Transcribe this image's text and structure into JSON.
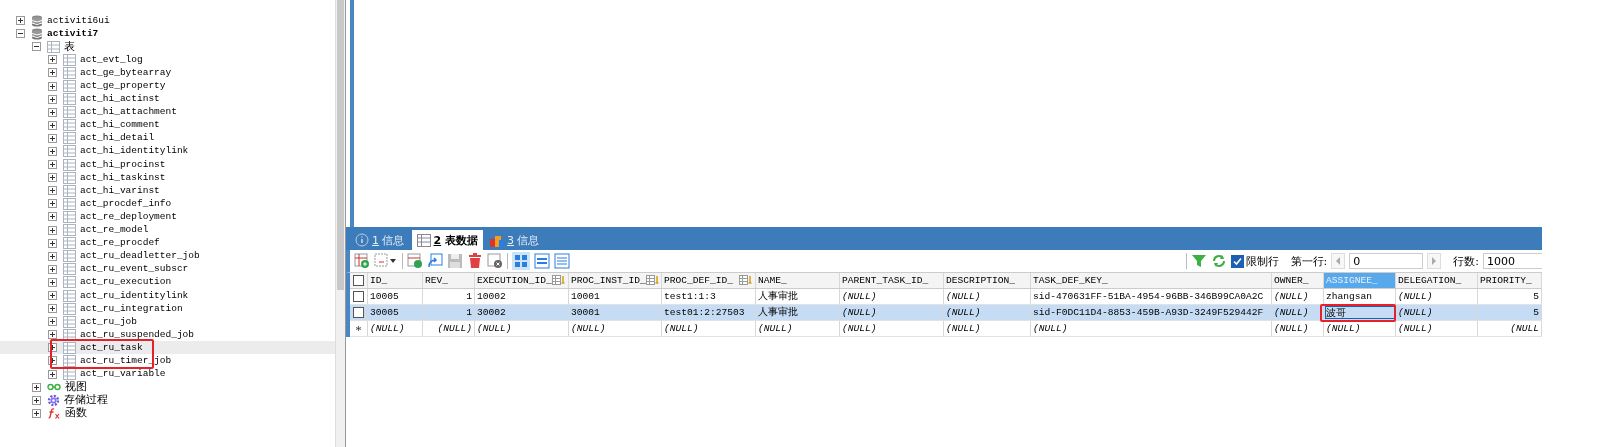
{
  "tree": [
    {
      "label": "activiti6ui",
      "kind": "database",
      "expanded": false,
      "selected": false
    },
    {
      "label": "activiti7",
      "kind": "database",
      "expanded": true,
      "selected": false,
      "children": [
        {
          "label": "表",
          "kind": "tables",
          "expanded": true,
          "selected": false,
          "children": [
            {
              "label": "act_evt_log",
              "kind": "table",
              "expanded": false,
              "selected": false
            },
            {
              "label": "act_ge_bytearray",
              "kind": "table",
              "expanded": false,
              "selected": false
            },
            {
              "label": "act_ge_property",
              "kind": "table",
              "expanded": false,
              "selected": false
            },
            {
              "label": "act_hi_actinst",
              "kind": "table",
              "expanded": false,
              "selected": false
            },
            {
              "label": "act_hi_attachment",
              "kind": "table",
              "expanded": false,
              "selected": false
            },
            {
              "label": "act_hi_comment",
              "kind": "table",
              "expanded": false,
              "selected": false
            },
            {
              "label": "act_hi_detail",
              "kind": "table",
              "expanded": false,
              "selected": false
            },
            {
              "label": "act_hi_identitylink",
              "kind": "table",
              "expanded": false,
              "selected": false
            },
            {
              "label": "act_hi_procinst",
              "kind": "table",
              "expanded": false,
              "selected": false
            },
            {
              "label": "act_hi_taskinst",
              "kind": "table",
              "expanded": false,
              "selected": false
            },
            {
              "label": "act_hi_varinst",
              "kind": "table",
              "expanded": false,
              "selected": false
            },
            {
              "label": "act_procdef_info",
              "kind": "table",
              "expanded": false,
              "selected": false
            },
            {
              "label": "act_re_deployment",
              "kind": "table",
              "expanded": false,
              "selected": false
            },
            {
              "label": "act_re_model",
              "kind": "table",
              "expanded": false,
              "selected": false
            },
            {
              "label": "act_re_procdef",
              "kind": "table",
              "expanded": false,
              "selected": false
            },
            {
              "label": "act_ru_deadletter_job",
              "kind": "table",
              "expanded": false,
              "selected": false
            },
            {
              "label": "act_ru_event_subscr",
              "kind": "table",
              "expanded": false,
              "selected": false
            },
            {
              "label": "act_ru_execution",
              "kind": "table",
              "expanded": false,
              "selected": false
            },
            {
              "label": "act_ru_identitylink",
              "kind": "table",
              "expanded": false,
              "selected": false
            },
            {
              "label": "act_ru_integration",
              "kind": "table",
              "expanded": false,
              "selected": false
            },
            {
              "label": "act_ru_job",
              "kind": "table",
              "expanded": false,
              "selected": false
            },
            {
              "label": "act_ru_suspended_job",
              "kind": "table",
              "expanded": false,
              "selected": false
            },
            {
              "label": "act_ru_task",
              "kind": "table",
              "expanded": false,
              "selected": true
            },
            {
              "label": "act_ru_timer_job",
              "kind": "table",
              "expanded": false,
              "selected": false
            },
            {
              "label": "act_ru_variable",
              "kind": "table",
              "expanded": false,
              "selected": false
            }
          ]
        },
        {
          "label": "视图",
          "kind": "views",
          "expanded": false,
          "selected": false
        },
        {
          "label": "存储过程",
          "kind": "procedures",
          "expanded": false,
          "selected": false
        },
        {
          "label": "函数",
          "kind": "functions",
          "expanded": false,
          "selected": false
        }
      ]
    }
  ],
  "tabs": [
    {
      "key": "1",
      "label": "信息",
      "kind": "info",
      "selected": false
    },
    {
      "key": "2",
      "label": "表数据",
      "kind": "table",
      "selected": true
    },
    {
      "key": "3",
      "label": "信息",
      "kind": "profile",
      "selected": false
    }
  ],
  "toolbar": {
    "limit_rows": {
      "label": "限制行",
      "checked": true
    },
    "first_row": {
      "label": "第一行:",
      "value": "0"
    },
    "row_count": {
      "label": "行数:",
      "value": "1000"
    }
  },
  "table": {
    "all_checked": false,
    "columns": [
      {
        "label": "ID_",
        "selected": false,
        "key_icon": false
      },
      {
        "label": "REV_",
        "selected": false,
        "key_icon": false
      },
      {
        "label": "EXECUTION_ID_",
        "selected": false,
        "key_icon": true
      },
      {
        "label": "PROC_INST_ID_",
        "selected": false,
        "key_icon": true
      },
      {
        "label": "PROC_DEF_ID_",
        "selected": false,
        "key_icon": true
      },
      {
        "label": "NAME_",
        "selected": false,
        "key_icon": false
      },
      {
        "label": "PARENT_TASK_ID_",
        "selected": false,
        "key_icon": false
      },
      {
        "label": "DESCRIPTION_",
        "selected": false,
        "key_icon": false
      },
      {
        "label": "TASK_DEF_KEY_",
        "selected": false,
        "key_icon": false
      },
      {
        "label": "OWNER_",
        "selected": false,
        "key_icon": false
      },
      {
        "label": "ASSIGNEE_",
        "selected": true,
        "key_icon": false
      },
      {
        "label": "DELEGATION_",
        "selected": false,
        "key_icon": false
      },
      {
        "label": "PRIORITY_",
        "selected": false,
        "key_icon": false
      }
    ],
    "rows": [
      {
        "kind": "data",
        "selected": false,
        "checked": false,
        "cells": [
          {
            "text": "10005",
            "null": false,
            "editing": false
          },
          {
            "text": "1",
            "null": false,
            "editing": false
          },
          {
            "text": "10002",
            "null": false,
            "editing": false
          },
          {
            "text": "10001",
            "null": false,
            "editing": false
          },
          {
            "text": "test1:1:3",
            "null": false,
            "editing": false
          },
          {
            "text": "人事审批",
            "null": false,
            "editing": false
          },
          {
            "text": "(NULL)",
            "null": true,
            "editing": false
          },
          {
            "text": "(NULL)",
            "null": true,
            "editing": false
          },
          {
            "text": "sid-470631FF-51BA-4954-96BB-346B99CA0A2C",
            "null": false,
            "editing": false
          },
          {
            "text": "(NULL)",
            "null": true,
            "editing": false
          },
          {
            "text": "zhangsan",
            "null": false,
            "editing": false
          },
          {
            "text": "(NULL)",
            "null": true,
            "editing": false
          },
          {
            "text": "5",
            "null": false,
            "editing": false
          }
        ]
      },
      {
        "kind": "data",
        "selected": true,
        "checked": false,
        "cells": [
          {
            "text": "30005",
            "null": false,
            "editing": false
          },
          {
            "text": "1",
            "null": false,
            "editing": false
          },
          {
            "text": "30002",
            "null": false,
            "editing": false
          },
          {
            "text": "30001",
            "null": false,
            "editing": false
          },
          {
            "text": "test01:2:27503",
            "null": false,
            "editing": false
          },
          {
            "text": "人事审批",
            "null": false,
            "editing": false
          },
          {
            "text": "(NULL)",
            "null": true,
            "editing": false
          },
          {
            "text": "(NULL)",
            "null": true,
            "editing": false
          },
          {
            "text": "sid-F0DC11D4-8853-459B-A93D-3249F529442F",
            "null": false,
            "editing": false
          },
          {
            "text": "(NULL)",
            "null": true,
            "editing": false
          },
          {
            "text": "波哥",
            "null": false,
            "editing": true
          },
          {
            "text": "(NULL)",
            "null": true,
            "editing": false
          },
          {
            "text": "5",
            "null": false,
            "editing": false
          }
        ]
      },
      {
        "kind": "new",
        "selected": false,
        "cells": [
          {
            "text": "(NULL)",
            "null": true,
            "editing": false
          },
          {
            "text": "(NULL)",
            "null": true,
            "editing": false
          },
          {
            "text": "(NULL)",
            "null": true,
            "editing": false
          },
          {
            "text": "(NULL)",
            "null": true,
            "editing": false
          },
          {
            "text": "(NULL)",
            "null": true,
            "editing": false
          },
          {
            "text": "(NULL)",
            "null": true,
            "editing": false
          },
          {
            "text": "(NULL)",
            "null": true,
            "editing": false
          },
          {
            "text": "(NULL)",
            "null": true,
            "editing": false
          },
          {
            "text": "(NULL)",
            "null": true,
            "editing": false
          },
          {
            "text": "(NULL)",
            "null": true,
            "editing": false
          },
          {
            "text": "(NULL)",
            "null": true,
            "editing": false
          },
          {
            "text": "(NULL)",
            "null": true,
            "editing": false
          },
          {
            "text": "(NULL",
            "null": true,
            "editing": false
          }
        ]
      }
    ]
  }
}
